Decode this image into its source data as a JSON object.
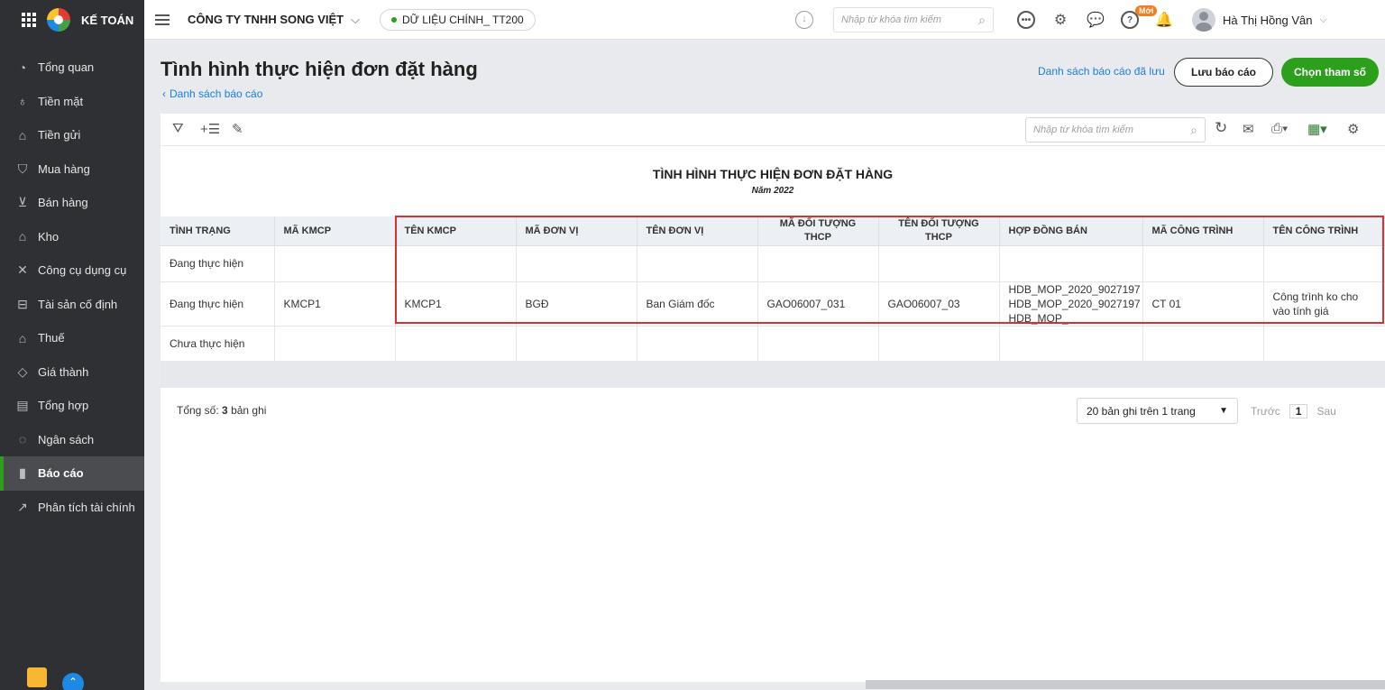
{
  "sidebar": {
    "brand": "KẾ TOÁN",
    "items": [
      {
        "label": "Tổng quan",
        "icon": "chart-pie-icon",
        "glyph": "◔"
      },
      {
        "label": "Tiền mặt",
        "icon": "money-bag-icon",
        "glyph": "♁"
      },
      {
        "label": "Tiền gửi",
        "icon": "bank-icon",
        "glyph": "⌂"
      },
      {
        "label": "Mua hàng",
        "icon": "shopping-bag-icon",
        "glyph": "⛉"
      },
      {
        "label": "Bán hàng",
        "icon": "cart-icon",
        "glyph": "⊻"
      },
      {
        "label": "Kho",
        "icon": "warehouse-icon",
        "glyph": "⌂"
      },
      {
        "label": "Công cụ dụng cụ",
        "icon": "tools-icon",
        "glyph": "✕"
      },
      {
        "label": "Tài sản cố định",
        "icon": "car-icon",
        "glyph": "⊟"
      },
      {
        "label": "Thuế",
        "icon": "building-icon",
        "glyph": "⌂"
      },
      {
        "label": "Giá thành",
        "icon": "tag-icon",
        "glyph": "◇"
      },
      {
        "label": "Tổng hợp",
        "icon": "ledger-icon",
        "glyph": "▤"
      },
      {
        "label": "Ngân sách",
        "icon": "budget-icon",
        "glyph": "◌"
      },
      {
        "label": "Báo cáo",
        "icon": "bar-chart-icon",
        "glyph": "▮",
        "active": true
      },
      {
        "label": "Phân tích tài chính",
        "icon": "trend-icon",
        "glyph": "↗"
      }
    ]
  },
  "topbar": {
    "company": "CÔNG TY TNHH SONG VIỆT",
    "database": "DỮ LIỆU CHÍNH_ TT200",
    "search_placeholder": "Nhập từ khóa tìm kiếm",
    "new_badge": "Mới",
    "user_name": "Hà Thị Hồng Vân"
  },
  "page": {
    "title": "Tình hình thực hiện đơn đặt hàng",
    "back_link": "Danh sách báo cáo",
    "saved_reports_link": "Danh sách báo cáo đã lưu",
    "save_button": "Lưu báo cáo",
    "params_button": "Chọn tham số"
  },
  "report": {
    "search_placeholder": "Nhập từ khóa tìm kiếm",
    "title": "TÌNH HÌNH THỰC HIỆN ĐƠN ĐẶT HÀNG",
    "subtitle": "Năm 2022",
    "columns": [
      "TÌNH TRẠNG",
      "MÃ KMCP",
      "TÊN KMCP",
      "MÃ ĐƠN VỊ",
      "TÊN ĐƠN VỊ",
      "MÃ ĐỐI TƯỢNG THCP",
      "TÊN ĐỐI TƯỢNG THCP",
      "HỢP ĐỒNG BÁN",
      "MÃ CÔNG TRÌNH",
      "TÊN CÔNG TRÌNH"
    ],
    "rows": [
      [
        "Đang thực hiện",
        "",
        "",
        "",
        "",
        "",
        "",
        "",
        "",
        ""
      ],
      [
        "Đang thực hiện",
        "KMCP1",
        "KMCP1",
        "BGĐ",
        "Ban Giám đốc",
        "GAO06007_031",
        "GAO06007_03",
        "HDB_MOP_2020_9027197\nHDB_MOP_2020_9027197\nHDB_MOP_",
        "CT 01",
        "Công trình ko cho vào tính giá"
      ],
      [
        "Chưa thực hiện",
        "",
        "",
        "",
        "",
        "",
        "",
        "",
        "",
        ""
      ]
    ]
  },
  "footer": {
    "total_label": "Tổng số:",
    "total_count": "3",
    "total_suffix": "bản ghi",
    "page_size": "20 bản ghi trên 1 trang",
    "prev": "Trước",
    "current_page": "1",
    "next": "Sau"
  }
}
